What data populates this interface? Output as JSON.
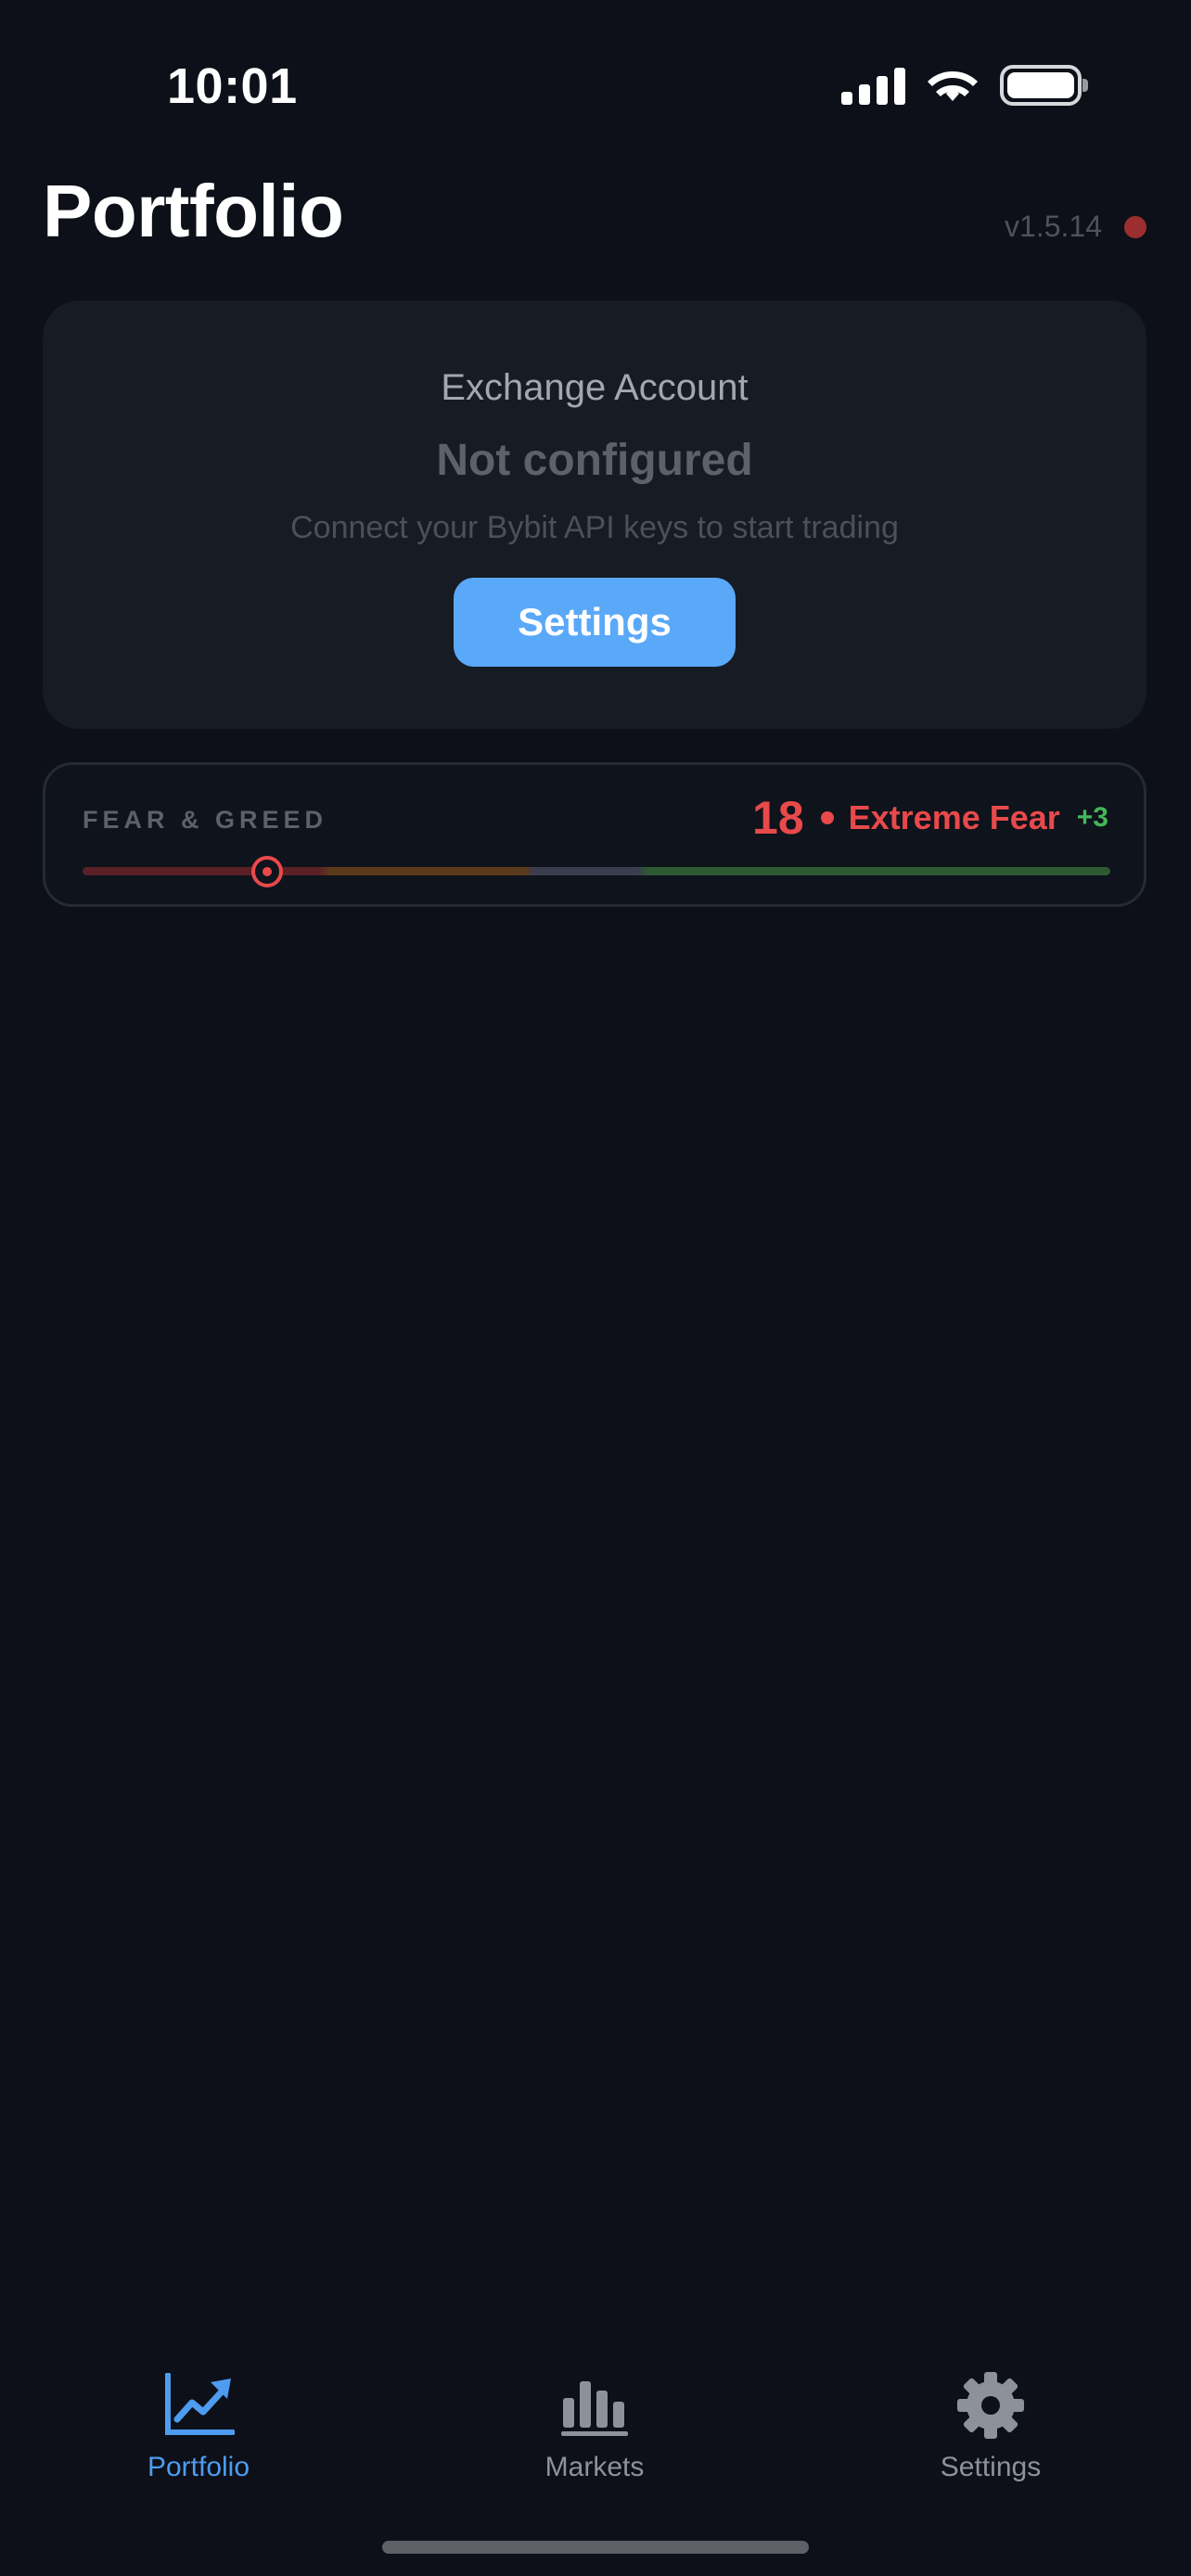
{
  "status_bar": {
    "time": "10:01"
  },
  "header": {
    "title": "Portfolio",
    "version": "v1.5.14"
  },
  "exchange_card": {
    "label": "Exchange Account",
    "status": "Not configured",
    "hint": "Connect your Bybit API keys to start trading",
    "button_label": "Settings"
  },
  "fear_greed": {
    "label": "FEAR & GREED",
    "value": "18",
    "classification": "Extreme Fear",
    "change": "+3",
    "level_percent": 18
  },
  "tab_bar": {
    "items": [
      {
        "label": "Portfolio",
        "icon": "chart-line-icon",
        "active": true
      },
      {
        "label": "Markets",
        "icon": "bar-chart-icon",
        "active": false
      },
      {
        "label": "Settings",
        "icon": "gear-icon",
        "active": false
      }
    ]
  },
  "colors": {
    "background": "#0d1018",
    "accent": "#5aa8f8",
    "fear": "#e8494b",
    "positive": "#43b65a",
    "disconnected": "#9b2f2f"
  }
}
